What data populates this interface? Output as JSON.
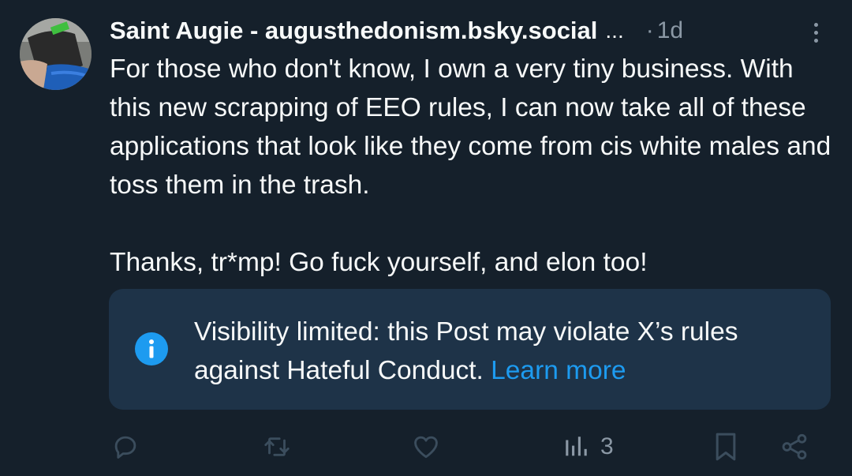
{
  "post": {
    "author_name": "Saint Augie - augusthedonism.bsky.social",
    "name_overflow": "...",
    "time_separator": "·",
    "timestamp": "1d",
    "text": "For those who don't know, I own a very tiny business. With this new scrapping of EEO rules, I can now take all of these applications that look like they come from cis white males and toss them in the trash.\n\nThanks, tr*mp! Go fuck yourself, and elon too!"
  },
  "notice": {
    "icon": "info-icon",
    "text": "Visibility limited: this Post may violate X’s rules against Hateful Conduct. ",
    "link_label": "Learn more"
  },
  "actions": {
    "reply_icon": "reply-icon",
    "repost_icon": "repost-icon",
    "like_icon": "heart-icon",
    "views_icon": "views-icon",
    "views_count": "3",
    "bookmark_icon": "bookmark-icon",
    "share_icon": "share-icon"
  },
  "colors": {
    "background": "#15202b",
    "notice_background": "#1e3348",
    "accent": "#1d9bf0",
    "secondary_text": "#8b98a5",
    "icon_muted": "#3b4d5d"
  }
}
